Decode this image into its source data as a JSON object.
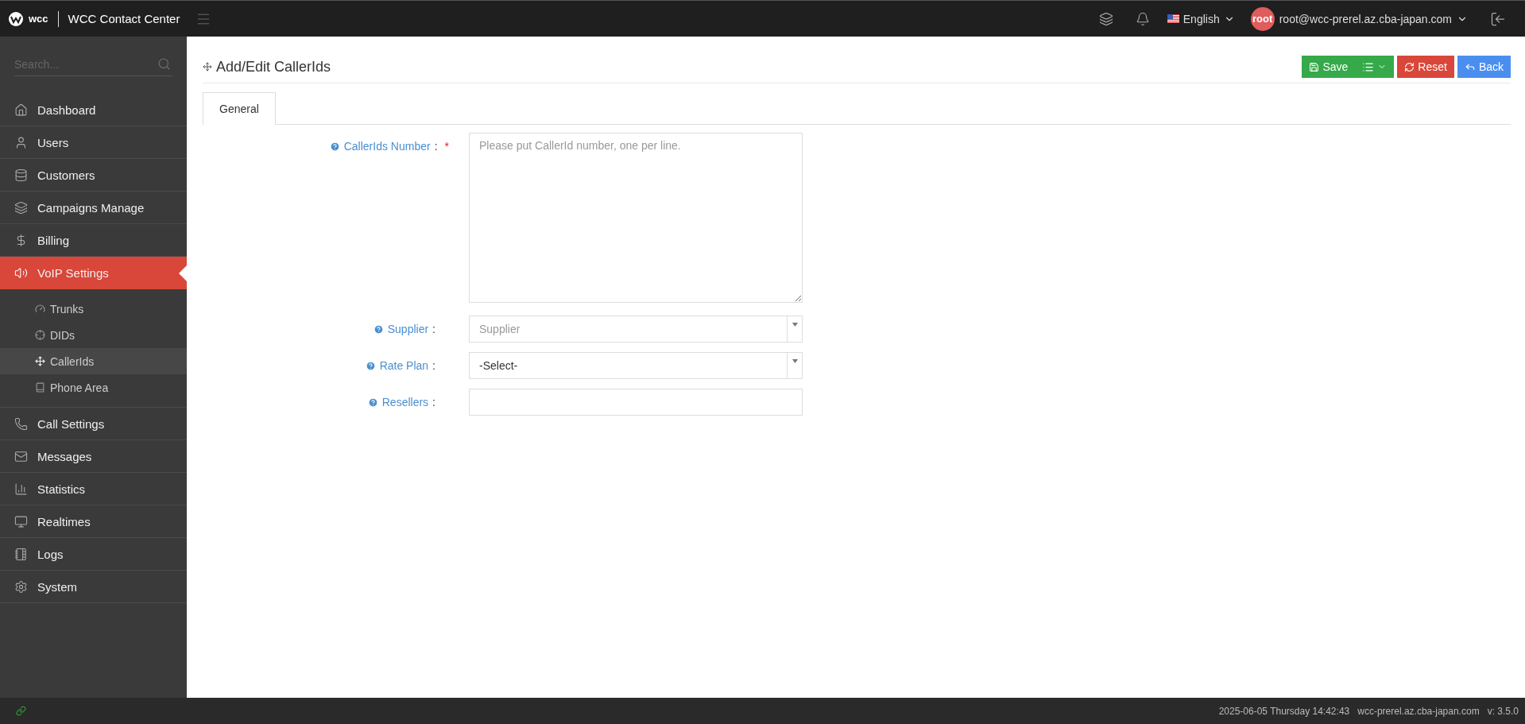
{
  "header": {
    "logo_text": "wcc",
    "app_title": "WCC Contact Center",
    "language": "English",
    "avatar": "root",
    "user": "root@wcc-prerel.az.cba-japan.com"
  },
  "sidebar": {
    "search": {
      "placeholder": "Search..."
    },
    "items": [
      {
        "label": "Dashboard",
        "selected": false
      },
      {
        "label": "Users",
        "selected": false
      },
      {
        "label": "Customers",
        "selected": false
      },
      {
        "label": "Campaigns Manage",
        "selected": false
      },
      {
        "label": "Billing",
        "selected": false
      },
      {
        "label": "VoIP Settings",
        "selected": true,
        "children": [
          {
            "label": "Trunks",
            "selected": false
          },
          {
            "label": "DIDs",
            "selected": false
          },
          {
            "label": "CallerIds",
            "selected": true
          },
          {
            "label": "Phone Area",
            "selected": false
          }
        ]
      },
      {
        "label": "Call Settings",
        "selected": false
      },
      {
        "label": "Messages",
        "selected": false
      },
      {
        "label": "Statistics",
        "selected": false
      },
      {
        "label": "Realtimes",
        "selected": false
      },
      {
        "label": "Logs",
        "selected": false
      },
      {
        "label": "System",
        "selected": false
      }
    ]
  },
  "page": {
    "title": "Add/Edit CallerIds",
    "buttons": [
      {
        "kind": "save",
        "label": "Save"
      },
      {
        "kind": "menu"
      },
      {
        "kind": "reset",
        "label": "Reset"
      },
      {
        "kind": "back",
        "label": "Back"
      }
    ],
    "tabs": [
      {
        "label": "General",
        "selected": true
      }
    ],
    "fields": [
      {
        "kind": "textarea",
        "label": "CallerIds Number",
        "separator": ":",
        "required_mark": "*",
        "placeholder": "Please put CallerId number, one per line."
      },
      {
        "kind": "select",
        "label": "Supplier",
        "separator": ":",
        "placeholder": "Supplier"
      },
      {
        "kind": "select",
        "label": "Rate Plan",
        "separator": ":",
        "value": "-Select-"
      },
      {
        "kind": "text",
        "label": "Resellers",
        "separator": ":"
      }
    ]
  },
  "status_bar": {
    "datetime": "2025-06-05 Thursday 14:42:43",
    "host": "wcc-prerel.az.cba-japan.com",
    "version": "v: 3.5.0"
  }
}
